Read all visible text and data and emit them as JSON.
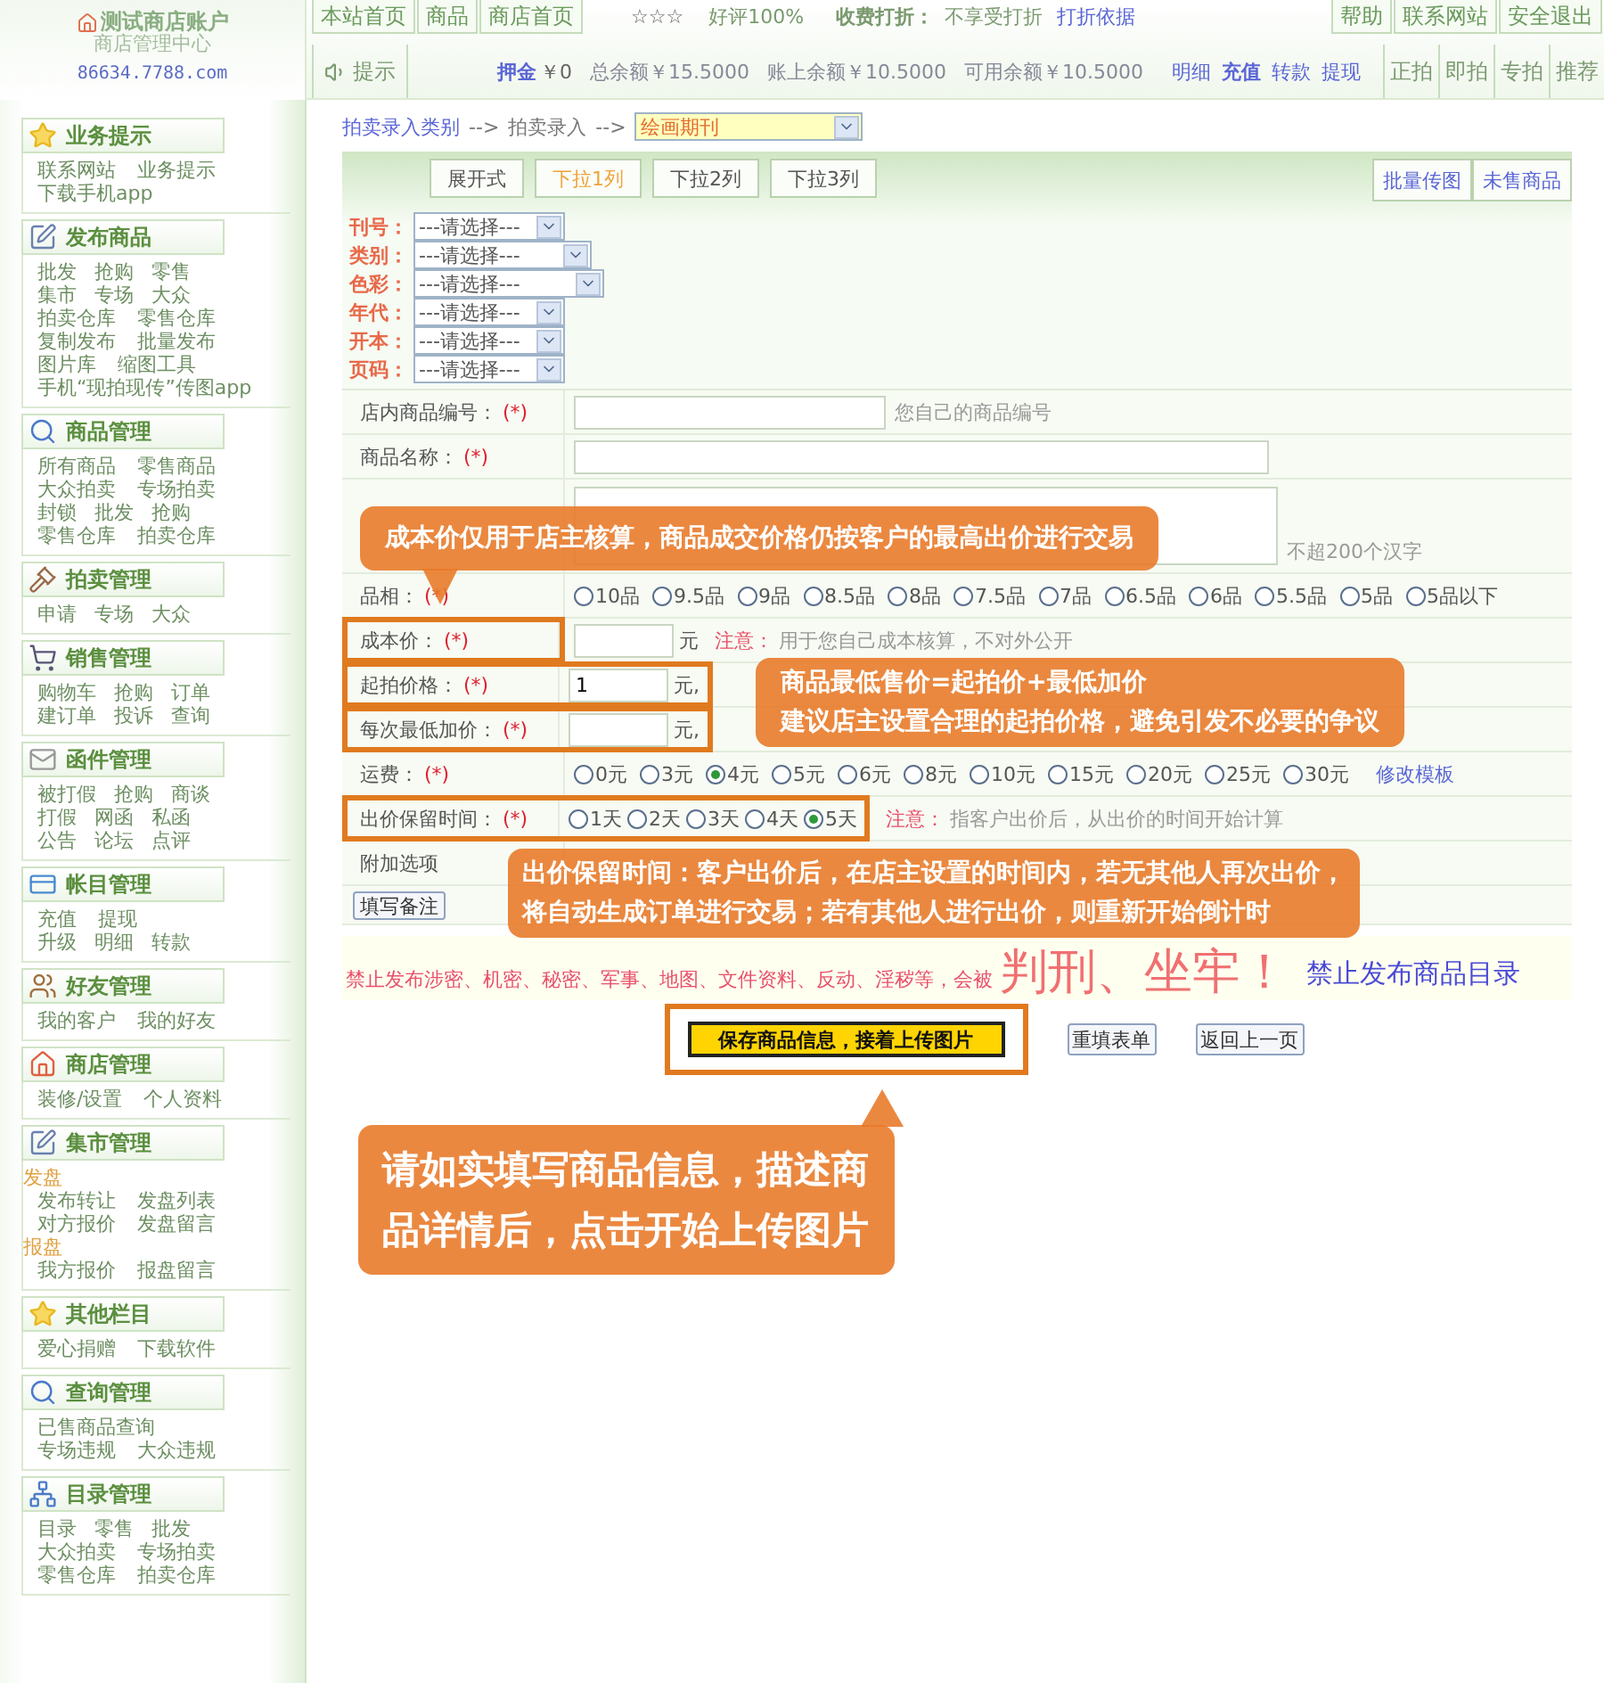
{
  "header": {
    "logo_title": "测试商店账户",
    "logo_subtitle": "商店管理中心",
    "domain": "86634.7788.com",
    "nav_buttons": [
      "本站首页",
      "商品",
      "商店首页"
    ],
    "stars": "☆☆☆",
    "rating": "好评100%",
    "discount_label": "收费打折：",
    "discount_value": "不享受打折",
    "discount_link": "打折依据",
    "right_buttons": [
      "帮助",
      "联系网站",
      "安全退出"
    ],
    "tip_button": "提示",
    "deposit_label": "押金",
    "deposit_value": "￥0",
    "balances": [
      "总余额￥15.5000",
      "账上余额￥10.5000",
      "可用余额￥10.5000"
    ],
    "account_links": [
      {
        "label": "明细",
        "bold": false
      },
      {
        "label": "充值",
        "bold": true
      },
      {
        "label": "转款",
        "bold": false
      },
      {
        "label": "提现",
        "bold": false
      }
    ],
    "auction_tabs": [
      "正拍",
      "即拍",
      "专拍",
      "推荐"
    ]
  },
  "sidebar": [
    {
      "title": "业务提示",
      "rows": [
        {
          "kind": "links",
          "items": [
            "联系网站",
            "业务提示"
          ]
        },
        {
          "kind": "links",
          "items": [
            "下载手机app"
          ]
        }
      ]
    },
    {
      "title": "发布商品",
      "rows": [
        {
          "kind": "links",
          "items": [
            "批发",
            "抢购",
            "零售"
          ]
        },
        {
          "kind": "links",
          "items": [
            "集市",
            "专场",
            "大众"
          ]
        },
        {
          "kind": "links",
          "items": [
            "拍卖仓库",
            "零售仓库"
          ]
        },
        {
          "kind": "links",
          "items": [
            "复制发布",
            "批量发布"
          ]
        },
        {
          "kind": "links",
          "items": [
            "图片库",
            "缩图工具"
          ]
        },
        {
          "kind": "links",
          "items": [
            "手机“现拍现传”传图app"
          ]
        }
      ]
    },
    {
      "title": "商品管理",
      "rows": [
        {
          "kind": "links",
          "items": [
            "所有商品",
            "零售商品"
          ]
        },
        {
          "kind": "links",
          "items": [
            "大众拍卖",
            "专场拍卖"
          ]
        },
        {
          "kind": "links",
          "items": [
            "封锁",
            "批发",
            "抢购"
          ]
        },
        {
          "kind": "links",
          "items": [
            "零售仓库",
            "拍卖仓库"
          ]
        }
      ]
    },
    {
      "title": "拍卖管理",
      "rows": [
        {
          "kind": "links",
          "items": [
            "申请",
            "专场",
            "大众"
          ]
        }
      ]
    },
    {
      "title": "销售管理",
      "rows": [
        {
          "kind": "links",
          "items": [
            "购物车",
            "抢购",
            "订单"
          ]
        },
        {
          "kind": "links",
          "items": [
            "建订单",
            "投诉",
            "查询"
          ]
        }
      ]
    },
    {
      "title": "函件管理",
      "rows": [
        {
          "kind": "links",
          "items": [
            "被打假",
            "抢购",
            "商谈"
          ]
        },
        {
          "kind": "links",
          "items": [
            "打假",
            "网函",
            "私函"
          ]
        },
        {
          "kind": "links",
          "items": [
            "公告",
            "论坛",
            "点评"
          ]
        }
      ]
    },
    {
      "title": "帐目管理",
      "rows": [
        {
          "kind": "links",
          "items": [
            "充值",
            "提现"
          ]
        },
        {
          "kind": "links",
          "items": [
            "升级",
            "明细",
            "转款"
          ]
        }
      ]
    },
    {
      "title": "好友管理",
      "rows": [
        {
          "kind": "links",
          "items": [
            "我的客户",
            "我的好友"
          ]
        }
      ]
    },
    {
      "title": "商店管理",
      "rows": [
        {
          "kind": "links",
          "items": [
            "装修/设置",
            "个人资料"
          ]
        }
      ]
    },
    {
      "title": "集市管理",
      "rows": [
        {
          "kind": "heading",
          "items": [
            "发盘"
          ]
        },
        {
          "kind": "links",
          "items": [
            "发布转让",
            "发盘列表"
          ]
        },
        {
          "kind": "links",
          "items": [
            "对方报价",
            "发盘留言"
          ]
        },
        {
          "kind": "heading",
          "items": [
            "报盘"
          ]
        },
        {
          "kind": "links",
          "items": [
            "我方报价",
            "报盘留言"
          ]
        }
      ]
    },
    {
      "title": "其他栏目",
      "rows": [
        {
          "kind": "links",
          "items": [
            "爱心捐赠",
            "下载软件"
          ]
        }
      ]
    },
    {
      "title": "查询管理",
      "rows": [
        {
          "kind": "links",
          "items": [
            "已售商品查询"
          ]
        },
        {
          "kind": "links",
          "items": [
            "专场违规",
            "大众违规"
          ]
        }
      ]
    },
    {
      "title": "目录管理",
      "rows": [
        {
          "kind": "links",
          "items": [
            "目录",
            "零售",
            "批发"
          ]
        },
        {
          "kind": "links",
          "items": [
            "大众拍卖",
            "专场拍卖"
          ]
        },
        {
          "kind": "links",
          "items": [
            "零售仓库",
            "拍卖仓库"
          ]
        }
      ]
    }
  ],
  "breadcrumb": [
    {
      "kind": "link",
      "text": "拍卖录入类别"
    },
    {
      "kind": "sep",
      "text": "-->"
    },
    {
      "kind": "text",
      "text": "拍卖录入"
    },
    {
      "kind": "sep",
      "text": "-->"
    },
    {
      "kind": "select",
      "text": "绘画期刊"
    }
  ],
  "view_tabs": [
    {
      "label": "展开式",
      "selected": false
    },
    {
      "label": "下拉1列",
      "selected": true
    },
    {
      "label": "下拉2列",
      "selected": false
    },
    {
      "label": "下拉3列",
      "selected": false
    }
  ],
  "toolbar_buttons": [
    "批量传图",
    "未售商品"
  ],
  "attributes": [
    {
      "label": "刊号：",
      "value": "---请选择---"
    },
    {
      "label": "类别：",
      "value": "---请选择---"
    },
    {
      "label": "色彩：",
      "value": "---请选择---"
    },
    {
      "label": "年代：",
      "value": "---请选择---"
    },
    {
      "label": "开本：",
      "value": "---请选择---"
    },
    {
      "label": "页码：",
      "value": "---请选择---"
    }
  ],
  "form_rows": [
    {
      "kind": "text",
      "label": "店内商品编号：",
      "required": "(*)",
      "hint": "您自己的商品编号",
      "label_highlighted": false,
      "field_highlighted": false
    },
    {
      "kind": "wide_text",
      "label": "商品名称：",
      "required": "(*)",
      "label_highlighted": false,
      "field_highlighted": false
    },
    {
      "kind": "textarea",
      "hint": "不超200个汉字",
      "label_highlighted": false,
      "field_highlighted": false
    },
    {
      "kind": "radios",
      "label": "品相：",
      "required": "(*)",
      "label_highlighted": false,
      "field_highlighted": false,
      "options": [
        {
          "label": "10品",
          "selected": false
        },
        {
          "label": "9.5品",
          "selected": false
        },
        {
          "label": "9品",
          "selected": false
        },
        {
          "label": "8.5品",
          "selected": false
        },
        {
          "label": "8品",
          "selected": false
        },
        {
          "label": "7.5品",
          "selected": false
        },
        {
          "label": "7品",
          "selected": false
        },
        {
          "label": "6.5品",
          "selected": false
        },
        {
          "label": "6品",
          "selected": false
        },
        {
          "label": "5.5品",
          "selected": false
        },
        {
          "label": "5品",
          "selected": false
        },
        {
          "label": "5品以下",
          "selected": false
        }
      ]
    },
    {
      "kind": "price",
      "label": "成本价：",
      "required": "(*)",
      "value": "",
      "unit": "元",
      "note_label": "注意：",
      "note": "用于您自己成本核算，不对外公开",
      "label_highlighted": true,
      "field_highlighted": false,
      "callout": [
        "成本价仅用于店主核算，商品成交价格仍按客户的最高出价进行交易"
      ]
    },
    {
      "kind": "price",
      "label": "起拍价格：",
      "required": "(*)",
      "value": "1",
      "unit": "元,",
      "label_highlighted": true,
      "field_highlighted": true,
      "callout": [
        "商品最低售价=起拍价+最低加价",
        "建议店主设置合理的起拍价格，避免引发不必要的争议"
      ]
    },
    {
      "kind": "price",
      "label": "每次最低加价：",
      "required": "(*)",
      "value": "",
      "unit": "元,",
      "label_highlighted": true,
      "field_highlighted": true
    },
    {
      "kind": "radios",
      "label": "运费：",
      "required": "(*)",
      "label_highlighted": false,
      "field_highlighted": false,
      "link": "修改模板",
      "options": [
        {
          "label": "0元",
          "selected": false
        },
        {
          "label": "3元",
          "selected": false
        },
        {
          "label": "4元",
          "selected": true
        },
        {
          "label": "5元",
          "selected": false
        },
        {
          "label": "6元",
          "selected": false
        },
        {
          "label": "8元",
          "selected": false
        },
        {
          "label": "10元",
          "selected": false
        },
        {
          "label": "15元",
          "selected": false
        },
        {
          "label": "20元",
          "selected": false
        },
        {
          "label": "25元",
          "selected": false
        },
        {
          "label": "30元",
          "selected": false
        }
      ]
    },
    {
      "kind": "radios",
      "label": "出价保留时间：",
      "required": "(*)",
      "label_highlighted": true,
      "field_highlighted": true,
      "note_label": "注意：",
      "note": "指客户出价后，从出价的时间开始计算",
      "options": [
        {
          "label": "1天",
          "selected": false
        },
        {
          "label": "2天",
          "selected": false
        },
        {
          "label": "3天",
          "selected": false
        },
        {
          "label": "4天",
          "selected": false
        },
        {
          "label": "5天",
          "selected": true
        }
      ]
    },
    {
      "kind": "extra",
      "label": "附加选项",
      "label_highlighted": false,
      "field_highlighted": false,
      "callout": [
        "出价保留时间：客户出价后，在店主设置的时间内，若无其他人再次出价，",
        "将自动生成订单进行交易；若有其他人进行出价，则重新开始倒计时"
      ]
    },
    {
      "kind": "button",
      "button": "填写备注",
      "label_highlighted": false,
      "field_highlighted": false
    }
  ],
  "warning": {
    "text": "禁止发布涉密、机密、秘密、军事、地图、文件资料、反动、淫秽等，会被",
    "emphasis": "判刑、坐牢！",
    "link": "禁止发布商品目录"
  },
  "actions": [
    {
      "label": "保存商品信息，接着上传图片",
      "kind": "primary",
      "highlighted": true,
      "callout": [
        "请如实填写商品信息，描述商",
        "品详情后，点击开始上传图片"
      ]
    },
    {
      "label": "重填表单",
      "kind": "secondary",
      "highlighted": false
    },
    {
      "label": "返回上一页",
      "kind": "secondary",
      "highlighted": false
    }
  ]
}
